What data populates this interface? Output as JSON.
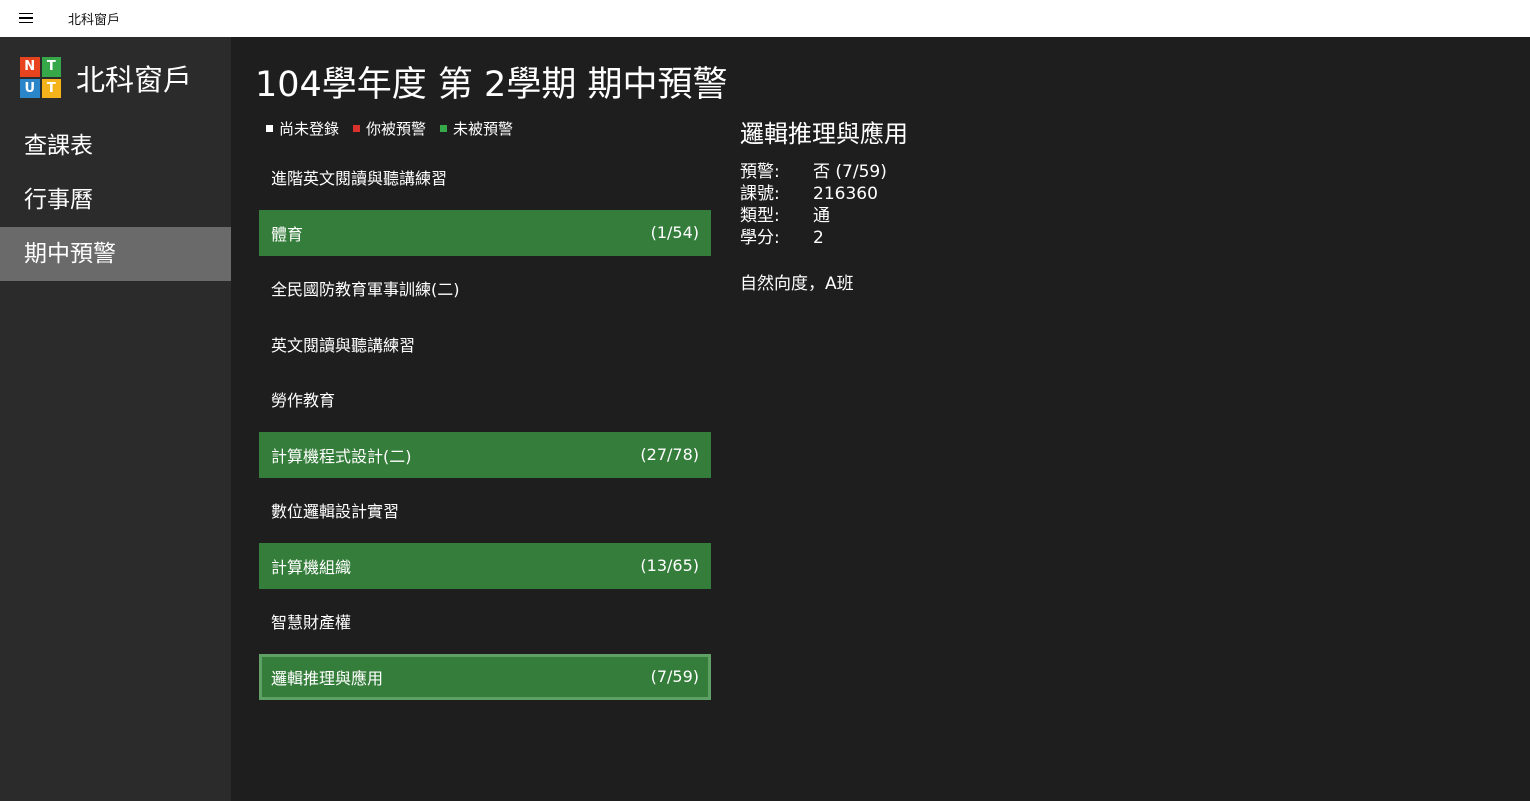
{
  "window": {
    "title": "北科窗戶"
  },
  "sidebar": {
    "logo_letters": [
      "N",
      "T",
      "U",
      "T"
    ],
    "logo_colors": [
      "#e8431f",
      "#37a84a",
      "#2a86c9",
      "#f4b31b"
    ],
    "title": "北科窗戶",
    "items": [
      {
        "label": "查課表"
      },
      {
        "label": "行事曆"
      },
      {
        "label": "期中預警"
      }
    ]
  },
  "main": {
    "title": "104學年度 第 2學期 期中預警",
    "legend": [
      {
        "label": "尚未登錄",
        "color": "#ffffff"
      },
      {
        "label": "你被預警",
        "color": "#d9312b"
      },
      {
        "label": "未被預警",
        "color": "#37a84a"
      }
    ],
    "courses": [
      {
        "name": "進階英文閱讀與聽講練習",
        "count": "",
        "status": "none"
      },
      {
        "name": "體育",
        "count": "(1/54)",
        "status": "not-warned"
      },
      {
        "name": "全民國防教育軍事訓練(二)",
        "count": "",
        "status": "none"
      },
      {
        "name": "英文閱讀與聽講練習",
        "count": "",
        "status": "none"
      },
      {
        "name": "勞作教育",
        "count": "",
        "status": "none"
      },
      {
        "name": "計算機程式設計(二)",
        "count": "(27/78)",
        "status": "not-warned"
      },
      {
        "name": "數位邏輯設計實習",
        "count": "",
        "status": "none"
      },
      {
        "name": "計算機組織",
        "count": "(13/65)",
        "status": "not-warned"
      },
      {
        "name": "智慧財產權",
        "count": "",
        "status": "none"
      },
      {
        "name": "邏輯推理與應用",
        "count": "(7/59)",
        "status": "not-warned",
        "selected": true
      }
    ]
  },
  "detail": {
    "title": "邏輯推理與應用",
    "rows": [
      {
        "key": "預警:",
        "value": "否 (7/59)"
      },
      {
        "key": "課號:",
        "value": "216360"
      },
      {
        "key": "類型:",
        "value": "通"
      },
      {
        "key": "學分:",
        "value": "2"
      }
    ],
    "note": "自然向度，A班"
  },
  "colors": {
    "background": "#1e1e1e",
    "sidebar": "#2b2b2b",
    "active_nav": "#6a6a6a",
    "not_warned": "#347d3a"
  }
}
